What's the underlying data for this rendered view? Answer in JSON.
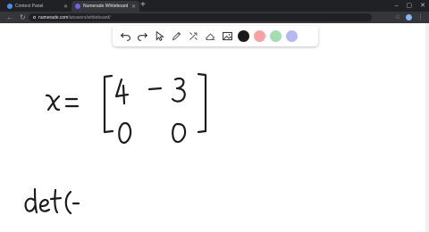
{
  "browser": {
    "tabs": [
      {
        "title": "Context Panel",
        "active": false
      },
      {
        "title": "Numerade Whiteboard",
        "active": true
      }
    ],
    "new_tab_label": "+",
    "url_host": "numerade.com",
    "url_path": "/answers/whiteboard/",
    "icons": [
      "back-arrow-icon",
      "forward-arrow-icon",
      "reload-icon",
      "lock-icon",
      "star-icon",
      "profile-icon",
      "menu-icon"
    ]
  },
  "palette": {
    "tools": [
      "undo-icon",
      "redo-icon",
      "select-icon",
      "pen-icon",
      "tools-icon",
      "eraser-icon",
      "image-icon"
    ],
    "colors": [
      "#1a1a1a",
      "#f7a3a3",
      "#a3ddb0",
      "#b7b7f2"
    ]
  },
  "whiteboard": {
    "handwriting_lines": [
      "x = [4 -3 / 0 0]",
      "det(-"
    ]
  }
}
